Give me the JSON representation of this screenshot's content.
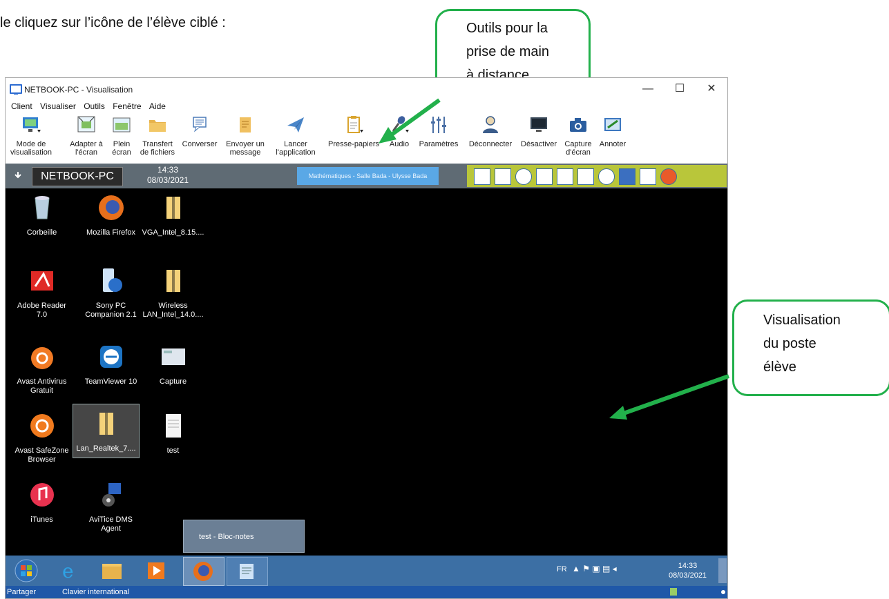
{
  "intro_text": "le cliquez sur l’icône de l’élève ciblé :",
  "callouts": {
    "tools": [
      "Outils pour la",
      "prise de main",
      "à distance"
    ],
    "view": [
      "Visualisation",
      "du poste",
      "élève"
    ]
  },
  "window": {
    "title": "NETBOOK-PC - Visualisation",
    "controls": {
      "minimize": "—",
      "maximize": "☐",
      "close": "✕"
    },
    "menu": [
      "Client",
      "Visualiser",
      "Outils",
      "Fenêtre",
      "Aide"
    ],
    "toolbar": [
      {
        "label": "Mode de\nvisualisation",
        "icon": "monitor-icon"
      },
      {
        "label": "Adapter à\nl'écran",
        "icon": "fit-screen-icon"
      },
      {
        "label": "Plein\nécran",
        "icon": "fullscreen-icon"
      },
      {
        "label": "Transfert\nde fichiers",
        "icon": "folder-icon"
      },
      {
        "label": "Converser",
        "icon": "chat-icon"
      },
      {
        "label": "Envoyer un\nmessage",
        "icon": "message-icon"
      },
      {
        "label": "Lancer\nl'application",
        "icon": "launch-icon"
      },
      {
        "label": "Presse-papiers",
        "icon": "clipboard-icon"
      },
      {
        "label": "Audio",
        "icon": "microphone-icon"
      },
      {
        "label": "Paramètres",
        "icon": "sliders-icon"
      },
      {
        "label": "Déconnecter",
        "icon": "user-disconnect-icon"
      },
      {
        "label": "Désactiver",
        "icon": "screen-off-icon"
      },
      {
        "label": "Capture\nd'écran",
        "icon": "camera-icon"
      },
      {
        "label": "Annoter",
        "icon": "annotate-icon"
      }
    ]
  },
  "remote": {
    "pc_name": "NETBOOK-PC",
    "time": "14:33",
    "date": "08/03/2021",
    "session": "Mathématiques - Salle Bada - Ulysse Bada",
    "desktop_icons": [
      {
        "label": "Corbeille",
        "icon": "recycle-bin-icon"
      },
      {
        "label": "Mozilla Firefox",
        "icon": "firefox-icon"
      },
      {
        "label": "VGA_Intel_8.15....",
        "icon": "zip-folder-icon"
      },
      {
        "label": "Adobe Reader\n7.0",
        "icon": "adobe-reader-icon"
      },
      {
        "label": "Sony PC\nCompanion 2.1",
        "icon": "sony-pc-icon"
      },
      {
        "label": "Wireless\nLAN_Intel_14.0....",
        "icon": "zip-folder-icon"
      },
      {
        "label": "Avast Antivirus\nGratuit",
        "icon": "avast-icon"
      },
      {
        "label": "TeamViewer 10",
        "icon": "teamviewer-icon"
      },
      {
        "label": "Capture",
        "icon": "image-file-icon"
      },
      {
        "label": "Avast SafeZone\nBrowser",
        "icon": "safezone-icon"
      },
      {
        "label": "Lan_Realtek_7....",
        "icon": "zip-folder-icon"
      },
      {
        "label": "test",
        "icon": "text-file-icon"
      },
      {
        "label": "iTunes",
        "icon": "itunes-icon"
      },
      {
        "label": "AviTice DMS\nAgent",
        "icon": "avitice-icon"
      }
    ],
    "popup": "test - Bloc-notes",
    "tray": {
      "lang": "FR",
      "time": "14:33",
      "date": "08/03/2021"
    },
    "status": {
      "left": "Partager",
      "right": "Clavier international"
    }
  }
}
